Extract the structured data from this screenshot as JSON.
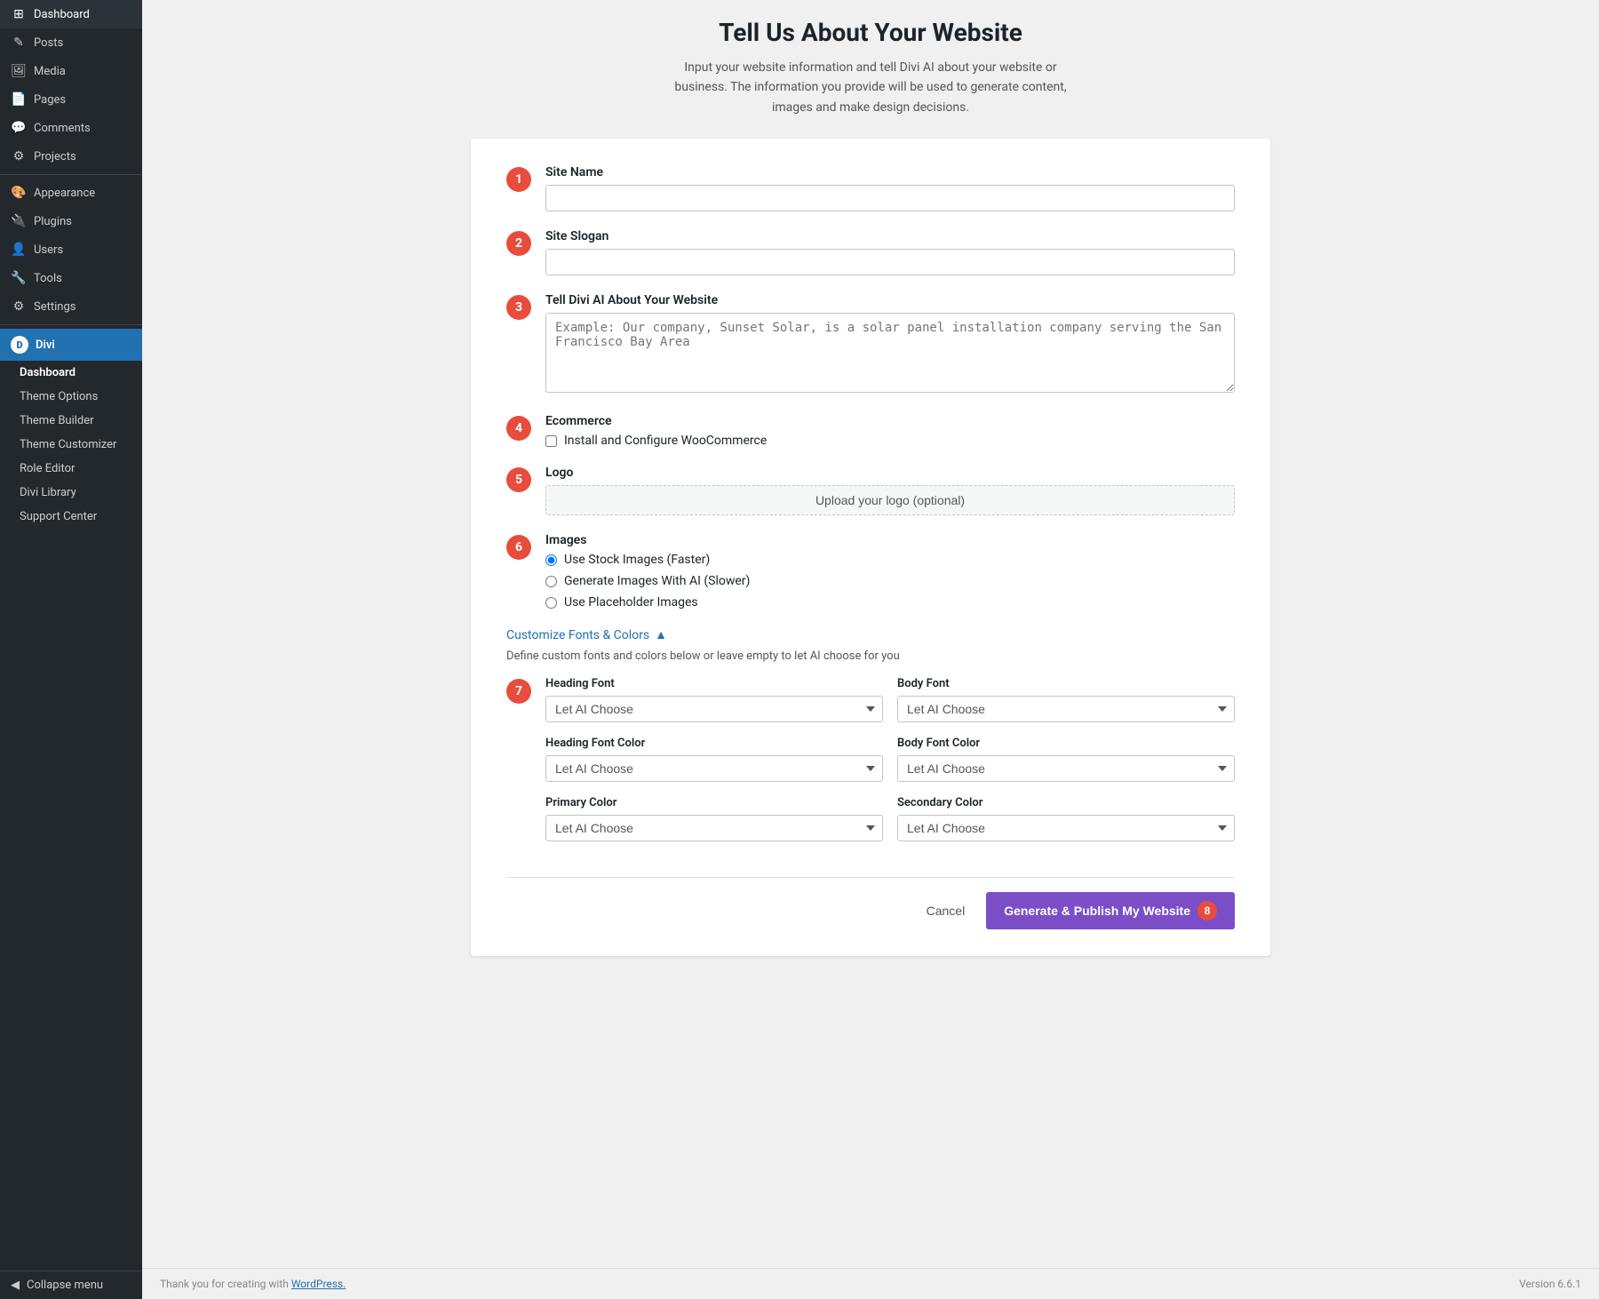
{
  "sidebar": {
    "items": [
      {
        "id": "dashboard",
        "label": "Dashboard",
        "icon": "⊞"
      },
      {
        "id": "posts",
        "label": "Posts",
        "icon": "✎"
      },
      {
        "id": "media",
        "label": "Media",
        "icon": "🖼"
      },
      {
        "id": "pages",
        "label": "Pages",
        "icon": "📄"
      },
      {
        "id": "comments",
        "label": "Comments",
        "icon": "💬"
      },
      {
        "id": "projects",
        "label": "Projects",
        "icon": "⚙"
      },
      {
        "id": "appearance",
        "label": "Appearance",
        "icon": "🎨"
      },
      {
        "id": "plugins",
        "label": "Plugins",
        "icon": "🔌"
      },
      {
        "id": "users",
        "label": "Users",
        "icon": "👤"
      },
      {
        "id": "tools",
        "label": "Tools",
        "icon": "🔧"
      },
      {
        "id": "settings",
        "label": "Settings",
        "icon": "⚙"
      }
    ],
    "divi_label": "Divi",
    "divi_icon": "D",
    "sub_items": [
      {
        "id": "dashboard-sub",
        "label": "Dashboard",
        "active": true
      },
      {
        "id": "theme-options",
        "label": "Theme Options"
      },
      {
        "id": "theme-builder",
        "label": "Theme Builder"
      },
      {
        "id": "theme-customizer",
        "label": "Theme Customizer"
      },
      {
        "id": "role-editor",
        "label": "Role Editor"
      },
      {
        "id": "divi-library",
        "label": "Divi Library"
      },
      {
        "id": "support-center",
        "label": "Support Center"
      }
    ],
    "collapse_label": "Collapse menu"
  },
  "page": {
    "title": "Tell Us About Your Website",
    "subtitle": "Input your website information and tell Divi AI about your website or business. The information you provide will be used to generate content, images and make design decisions."
  },
  "form": {
    "steps": [
      {
        "number": "1",
        "label": "Site Name",
        "type": "text",
        "placeholder": ""
      },
      {
        "number": "2",
        "label": "Site Slogan",
        "type": "text",
        "placeholder": ""
      },
      {
        "number": "3",
        "label": "Tell Divi AI About Your Website",
        "type": "textarea",
        "placeholder": "Example: Our company, Sunset Solar, is a solar panel installation company serving the San Francisco Bay Area"
      },
      {
        "number": "4",
        "label": "Ecommerce",
        "type": "checkbox",
        "checkbox_label": "Install and Configure WooCommerce"
      },
      {
        "number": "5",
        "label": "Logo",
        "type": "upload",
        "upload_label": "Upload your logo (optional)"
      },
      {
        "number": "6",
        "label": "Images",
        "type": "radio",
        "options": [
          {
            "id": "stock",
            "label": "Use Stock Images (Faster)",
            "selected": true
          },
          {
            "id": "ai",
            "label": "Generate Images With AI (Slower)",
            "selected": false
          },
          {
            "id": "placeholder",
            "label": "Use Placeholder Images",
            "selected": false
          }
        ]
      }
    ],
    "customize_toggle_label": "Customize Fonts & Colors",
    "customize_info": "Define custom fonts and colors below or leave empty to let AI choose for you",
    "fonts_step_number": "7",
    "font_fields": [
      {
        "id": "heading-font",
        "label": "Heading Font",
        "placeholder": "Let AI Choose"
      },
      {
        "id": "body-font",
        "label": "Body Font",
        "placeholder": "Let AI Choose"
      },
      {
        "id": "heading-font-color",
        "label": "Heading Font Color",
        "placeholder": "Let AI Choose"
      },
      {
        "id": "body-font-color",
        "label": "Body Font Color",
        "placeholder": "Let AI Choose"
      },
      {
        "id": "primary-color",
        "label": "Primary Color",
        "placeholder": "Let AI Choose"
      },
      {
        "id": "secondary-color",
        "label": "Secondary Color",
        "placeholder": "Let AI Choose"
      }
    ],
    "cancel_label": "Cancel",
    "generate_label": "Generate & Publish My Website",
    "generate_step_number": "8"
  },
  "footer": {
    "left_text": "Thank you for creating with",
    "wordpress_link": "WordPress.",
    "version": "Version 6.6.1"
  }
}
